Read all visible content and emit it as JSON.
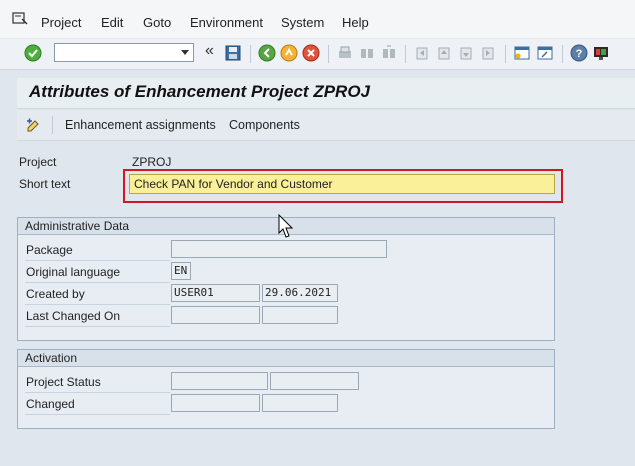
{
  "menu": {
    "items": [
      {
        "label": "Project"
      },
      {
        "label": "Edit"
      },
      {
        "label": "Goto"
      },
      {
        "label": "Environment"
      },
      {
        "label": "System"
      },
      {
        "label": "Help"
      }
    ]
  },
  "toolbar": {
    "command_field_value": "",
    "double_chevron": "«"
  },
  "header": {
    "title": "Attributes of Enhancement Project ZPROJ"
  },
  "app_toolbar": {
    "enhancement_assignments_label": "Enhancement assignments",
    "components_label": "Components"
  },
  "form": {
    "project_label": "Project",
    "project_value": "ZPROJ",
    "short_text_label": "Short text",
    "short_text_value": "Check PAN for Vendor and Customer"
  },
  "administrative_data": {
    "title": "Administrative Data",
    "package_label": "Package",
    "package_value": "",
    "original_language_label": "Original language",
    "original_language_value": "EN",
    "created_by_label": "Created by",
    "created_by_user": "USER01",
    "created_by_date": "29.06.2021",
    "last_changed_label": "Last Changed On",
    "last_changed_user": "",
    "last_changed_date": ""
  },
  "activation": {
    "title": "Activation",
    "project_status_label": "Project Status",
    "project_status_value1": "",
    "project_status_value2": "",
    "changed_label": "Changed",
    "changed_value1": "",
    "changed_value2": ""
  },
  "colors": {
    "highlight_border": "#d0191f",
    "input_yellow": "#fbf09a",
    "background": "#dfe6ee"
  }
}
